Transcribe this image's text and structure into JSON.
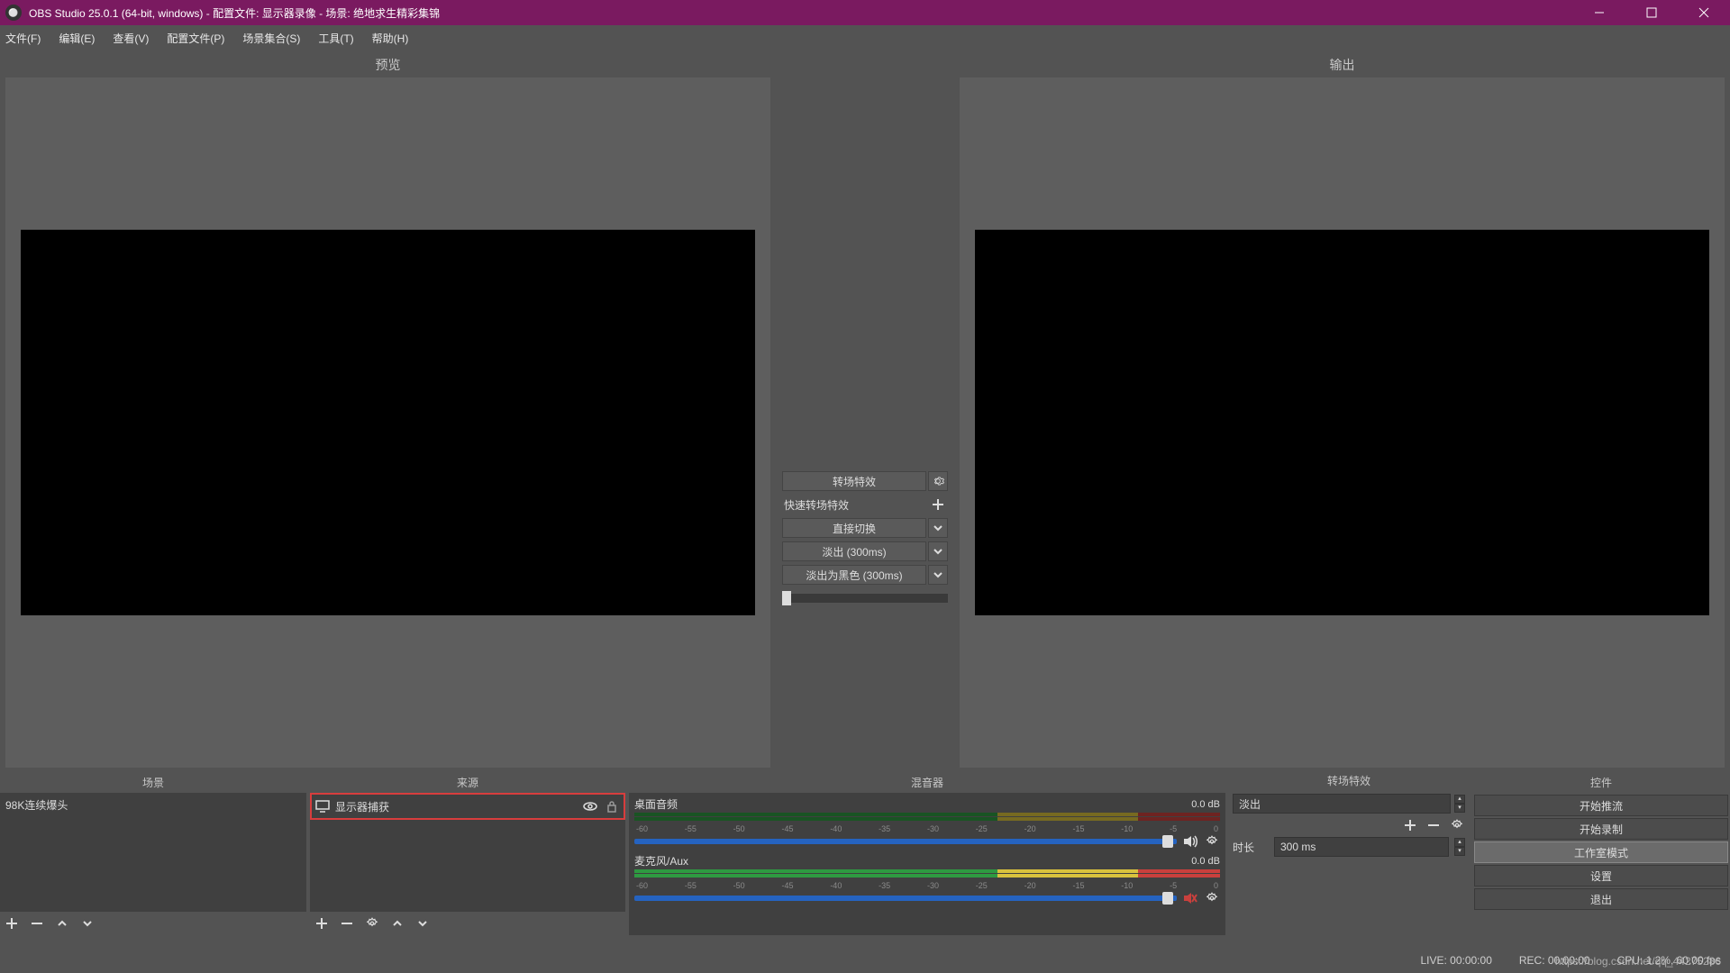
{
  "titlebar": {
    "title": "OBS Studio 25.0.1 (64-bit, windows) - 配置文件: 显示器录像 - 场景: 绝地求生精彩集锦"
  },
  "menu": {
    "file": "文件(F)",
    "edit": "编辑(E)",
    "view": "查看(V)",
    "profile": "配置文件(P)",
    "scene_collection": "场景集合(S)",
    "tools": "工具(T)",
    "help": "帮助(H)"
  },
  "main": {
    "preview_label": "预览",
    "output_label": "输出"
  },
  "transition_center": {
    "title": "转场特效",
    "quick_label": "快速转场特效",
    "items": [
      "直接切换",
      "淡出 (300ms)",
      "淡出为黑色 (300ms)"
    ]
  },
  "docks": {
    "scenes": {
      "title": "场景",
      "items": [
        "98K连续爆头"
      ]
    },
    "sources": {
      "title": "来源",
      "items": [
        {
          "name": "显示器捕获"
        }
      ]
    },
    "mixer": {
      "title": "混音器",
      "channels": [
        {
          "name": "桌面音频",
          "db": "0.0 dB",
          "muted": false
        },
        {
          "name": "麦克风/Aux",
          "db": "0.0 dB",
          "muted": true
        }
      ],
      "ticks": [
        "-60",
        "-55",
        "-50",
        "-45",
        "-40",
        "-35",
        "-30",
        "-25",
        "-20",
        "-15",
        "-10",
        "-5",
        "0"
      ]
    },
    "transition": {
      "title": "转场特效",
      "selected": "淡出",
      "duration_label": "时长",
      "duration_value": "300 ms"
    },
    "controls": {
      "title": "控件",
      "buttons": {
        "stream": "开始推流",
        "record": "开始录制",
        "studio": "工作室模式",
        "settings": "设置",
        "exit": "退出"
      }
    }
  },
  "status": {
    "live": "LIVE: 00:00:00",
    "rec": "REC: 00:00:00",
    "cpu": "CPU: 1.2%, 60.00 fps"
  },
  "watermark": "https://blog.csdn.net/qq_44275286"
}
